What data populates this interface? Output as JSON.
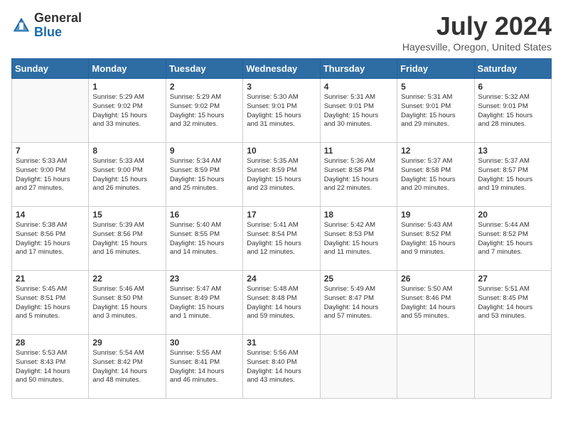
{
  "header": {
    "logo_general": "General",
    "logo_blue": "Blue",
    "main_title": "July 2024",
    "subtitle": "Hayesville, Oregon, United States"
  },
  "days_of_week": [
    "Sunday",
    "Monday",
    "Tuesday",
    "Wednesday",
    "Thursday",
    "Friday",
    "Saturday"
  ],
  "weeks": [
    [
      {
        "day": "",
        "info": ""
      },
      {
        "day": "1",
        "info": "Sunrise: 5:29 AM\nSunset: 9:02 PM\nDaylight: 15 hours\nand 33 minutes."
      },
      {
        "day": "2",
        "info": "Sunrise: 5:29 AM\nSunset: 9:02 PM\nDaylight: 15 hours\nand 32 minutes."
      },
      {
        "day": "3",
        "info": "Sunrise: 5:30 AM\nSunset: 9:01 PM\nDaylight: 15 hours\nand 31 minutes."
      },
      {
        "day": "4",
        "info": "Sunrise: 5:31 AM\nSunset: 9:01 PM\nDaylight: 15 hours\nand 30 minutes."
      },
      {
        "day": "5",
        "info": "Sunrise: 5:31 AM\nSunset: 9:01 PM\nDaylight: 15 hours\nand 29 minutes."
      },
      {
        "day": "6",
        "info": "Sunrise: 5:32 AM\nSunset: 9:01 PM\nDaylight: 15 hours\nand 28 minutes."
      }
    ],
    [
      {
        "day": "7",
        "info": "Sunrise: 5:33 AM\nSunset: 9:00 PM\nDaylight: 15 hours\nand 27 minutes."
      },
      {
        "day": "8",
        "info": "Sunrise: 5:33 AM\nSunset: 9:00 PM\nDaylight: 15 hours\nand 26 minutes."
      },
      {
        "day": "9",
        "info": "Sunrise: 5:34 AM\nSunset: 8:59 PM\nDaylight: 15 hours\nand 25 minutes."
      },
      {
        "day": "10",
        "info": "Sunrise: 5:35 AM\nSunset: 8:59 PM\nDaylight: 15 hours\nand 23 minutes."
      },
      {
        "day": "11",
        "info": "Sunrise: 5:36 AM\nSunset: 8:58 PM\nDaylight: 15 hours\nand 22 minutes."
      },
      {
        "day": "12",
        "info": "Sunrise: 5:37 AM\nSunset: 8:58 PM\nDaylight: 15 hours\nand 20 minutes."
      },
      {
        "day": "13",
        "info": "Sunrise: 5:37 AM\nSunset: 8:57 PM\nDaylight: 15 hours\nand 19 minutes."
      }
    ],
    [
      {
        "day": "14",
        "info": "Sunrise: 5:38 AM\nSunset: 8:56 PM\nDaylight: 15 hours\nand 17 minutes."
      },
      {
        "day": "15",
        "info": "Sunrise: 5:39 AM\nSunset: 8:56 PM\nDaylight: 15 hours\nand 16 minutes."
      },
      {
        "day": "16",
        "info": "Sunrise: 5:40 AM\nSunset: 8:55 PM\nDaylight: 15 hours\nand 14 minutes."
      },
      {
        "day": "17",
        "info": "Sunrise: 5:41 AM\nSunset: 8:54 PM\nDaylight: 15 hours\nand 12 minutes."
      },
      {
        "day": "18",
        "info": "Sunrise: 5:42 AM\nSunset: 8:53 PM\nDaylight: 15 hours\nand 11 minutes."
      },
      {
        "day": "19",
        "info": "Sunrise: 5:43 AM\nSunset: 8:52 PM\nDaylight: 15 hours\nand 9 minutes."
      },
      {
        "day": "20",
        "info": "Sunrise: 5:44 AM\nSunset: 8:52 PM\nDaylight: 15 hours\nand 7 minutes."
      }
    ],
    [
      {
        "day": "21",
        "info": "Sunrise: 5:45 AM\nSunset: 8:51 PM\nDaylight: 15 hours\nand 5 minutes."
      },
      {
        "day": "22",
        "info": "Sunrise: 5:46 AM\nSunset: 8:50 PM\nDaylight: 15 hours\nand 3 minutes."
      },
      {
        "day": "23",
        "info": "Sunrise: 5:47 AM\nSunset: 8:49 PM\nDaylight: 15 hours\nand 1 minute."
      },
      {
        "day": "24",
        "info": "Sunrise: 5:48 AM\nSunset: 8:48 PM\nDaylight: 14 hours\nand 59 minutes."
      },
      {
        "day": "25",
        "info": "Sunrise: 5:49 AM\nSunset: 8:47 PM\nDaylight: 14 hours\nand 57 minutes."
      },
      {
        "day": "26",
        "info": "Sunrise: 5:50 AM\nSunset: 8:46 PM\nDaylight: 14 hours\nand 55 minutes."
      },
      {
        "day": "27",
        "info": "Sunrise: 5:51 AM\nSunset: 8:45 PM\nDaylight: 14 hours\nand 53 minutes."
      }
    ],
    [
      {
        "day": "28",
        "info": "Sunrise: 5:53 AM\nSunset: 8:43 PM\nDaylight: 14 hours\nand 50 minutes."
      },
      {
        "day": "29",
        "info": "Sunrise: 5:54 AM\nSunset: 8:42 PM\nDaylight: 14 hours\nand 48 minutes."
      },
      {
        "day": "30",
        "info": "Sunrise: 5:55 AM\nSunset: 8:41 PM\nDaylight: 14 hours\nand 46 minutes."
      },
      {
        "day": "31",
        "info": "Sunrise: 5:56 AM\nSunset: 8:40 PM\nDaylight: 14 hours\nand 43 minutes."
      },
      {
        "day": "",
        "info": ""
      },
      {
        "day": "",
        "info": ""
      },
      {
        "day": "",
        "info": ""
      }
    ]
  ]
}
